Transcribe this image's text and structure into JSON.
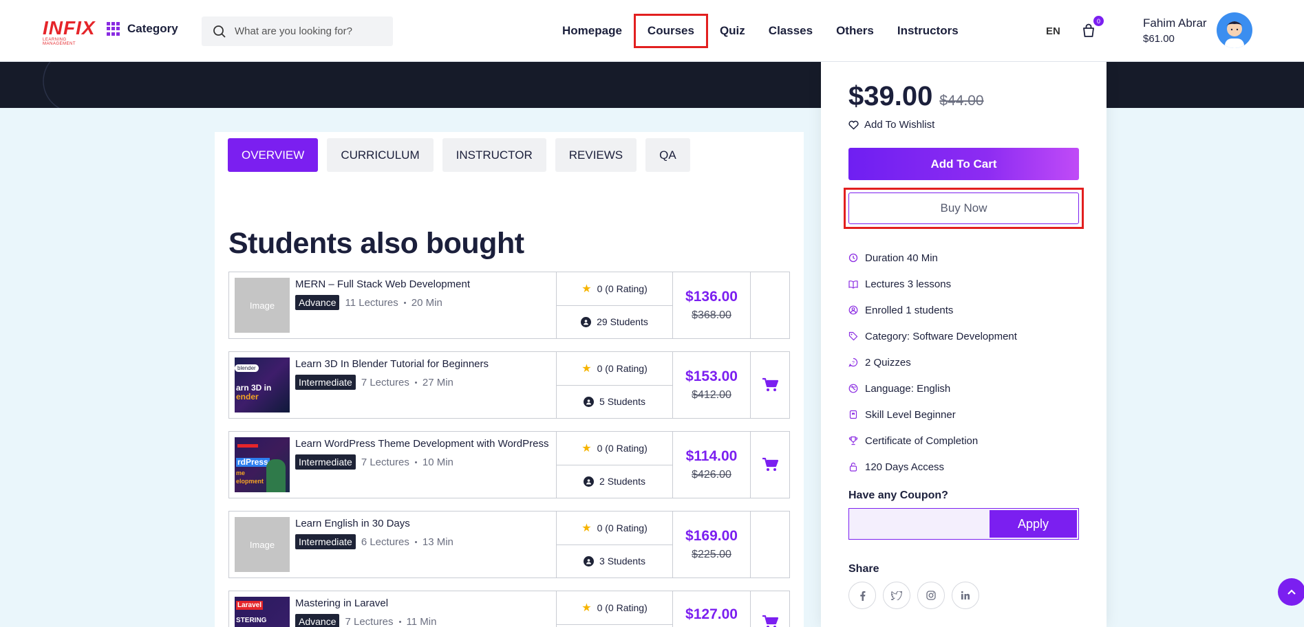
{
  "header": {
    "logo": "INFIX",
    "logo_sub": "LEARNING MANAGEMENT",
    "category_label": "Category",
    "search_placeholder": "What are you looking for?",
    "nav": [
      "Homepage",
      "Courses",
      "Quiz",
      "Classes",
      "Others",
      "Instructors"
    ],
    "active_nav": "Courses",
    "language": "EN",
    "cart_count": "0",
    "user_name": "Fahim Abrar",
    "user_balance": "$61.00"
  },
  "tabs": [
    "OVERVIEW",
    "CURRICULUM",
    "INSTRUCTOR",
    "REVIEWS",
    "QA"
  ],
  "active_tab": "OVERVIEW",
  "section_title": "Students also bought",
  "courses": [
    {
      "title": "MERN – Full Stack Web Development",
      "level": "Advance",
      "lectures": "11 Lectures",
      "duration": "20 Min",
      "rating": "0 (0 Rating)",
      "students": "29 Students",
      "price": "$136.00",
      "old_price": "$368.00",
      "thumb": "Image",
      "has_cart": false
    },
    {
      "title": "Learn 3D In Blender Tutorial for Beginners",
      "level": "Intermediate",
      "lectures": "7 Lectures",
      "duration": "27 Min",
      "rating": "0 (0 Rating)",
      "students": "5 Students",
      "price": "$153.00",
      "old_price": "$412.00",
      "thumb": "blender",
      "has_cart": true
    },
    {
      "title": "Learn WordPress Theme Development with WordPress",
      "level": "Intermediate",
      "lectures": "7 Lectures",
      "duration": "10 Min",
      "rating": "0 (0 Rating)",
      "students": "2 Students",
      "price": "$114.00",
      "old_price": "$426.00",
      "thumb": "wordpress",
      "has_cart": true
    },
    {
      "title": "Learn English in 30 Days",
      "level": "Intermediate",
      "lectures": "6 Lectures",
      "duration": "13 Min",
      "rating": "0 (0 Rating)",
      "students": "3 Students",
      "price": "$169.00",
      "old_price": "$225.00",
      "thumb": "Image",
      "has_cart": false
    },
    {
      "title": "Mastering in Laravel",
      "level": "Advance",
      "lectures": "7 Lectures",
      "duration": "11 Min",
      "rating": "0 (0 Rating)",
      "students": "",
      "price": "$127.00",
      "old_price": "",
      "thumb": "laravel",
      "has_cart": true
    }
  ],
  "sidebar": {
    "price": "$39.00",
    "old_price": "$44.00",
    "wishlist_label": "Add To Wishlist",
    "add_to_cart_label": "Add To Cart",
    "buy_now_label": "Buy Now",
    "features": [
      {
        "icon": "clock-icon",
        "label": "Duration 40 Min"
      },
      {
        "icon": "book-icon",
        "label": "Lectures 3 lessons"
      },
      {
        "icon": "user-icon",
        "label": "Enrolled 1 students"
      },
      {
        "icon": "tag-icon",
        "label": "Category: Software Development"
      },
      {
        "icon": "quiz-icon",
        "label": "2 Quizzes"
      },
      {
        "icon": "language-icon",
        "label": "Language: English"
      },
      {
        "icon": "skill-icon",
        "label": "Skill Level Beginner"
      },
      {
        "icon": "trophy-icon",
        "label": "Certificate of Completion"
      },
      {
        "icon": "lock-icon",
        "label": "120 Days Access"
      }
    ],
    "coupon_label": "Have any Coupon?",
    "coupon_value": "",
    "apply_label": "Apply",
    "share_label": "Share",
    "share_icons": [
      "facebook-icon",
      "twitter-icon",
      "instagram-icon",
      "linkedin-icon"
    ]
  },
  "colors": {
    "accent": "#7b1ff0",
    "highlight": "#e21f1f",
    "dark": "#161b29"
  }
}
